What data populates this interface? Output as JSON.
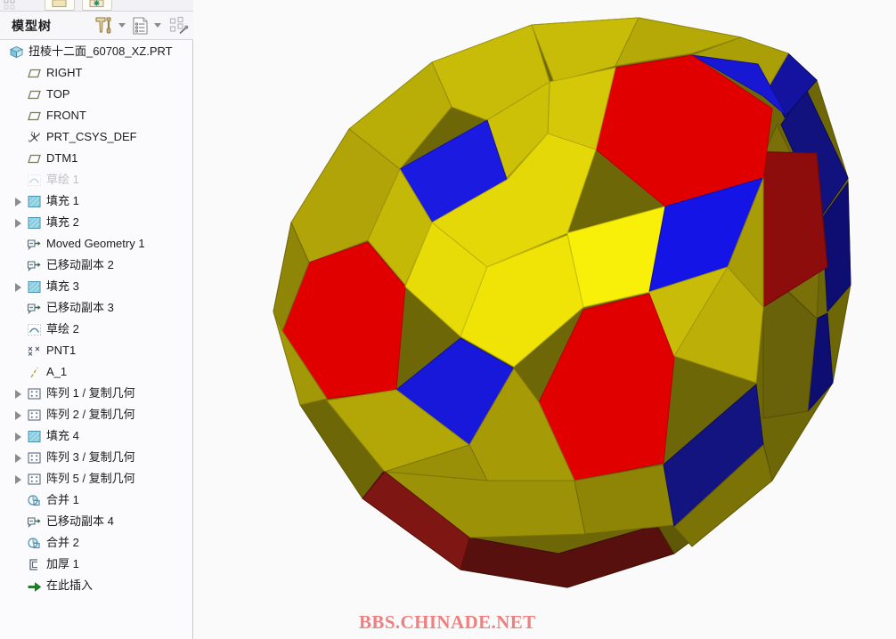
{
  "window": {
    "background": "#fafafa",
    "panel_background": "#fbfbfd"
  },
  "ribbon": {
    "buttons": [
      {
        "name": "new-window-button",
        "icon": "window-icon"
      },
      {
        "name": "style-button",
        "icon": "asterisk-icon"
      }
    ]
  },
  "panel": {
    "title": "模型树",
    "tools": [
      {
        "name": "settings-tools-button",
        "icon": "hammer-screwdriver-icon",
        "label": ""
      },
      {
        "name": "settings-dropdown",
        "icon": "chevron-down-icon",
        "label": ""
      },
      {
        "name": "display-list-button",
        "icon": "list-document-icon",
        "label": ""
      },
      {
        "name": "display-dropdown",
        "icon": "chevron-down-icon",
        "label": ""
      },
      {
        "name": "tree-filter-button",
        "icon": "tree-filter-icon",
        "label": ""
      }
    ]
  },
  "tree": {
    "items": [
      {
        "label": "扭棱十二面_60708_XZ.PRT",
        "icon": "part-cube-icon",
        "level": 0,
        "expander": false,
        "dim": false
      },
      {
        "label": "RIGHT",
        "icon": "datum-plane-icon",
        "level": 1,
        "expander": false,
        "dim": false
      },
      {
        "label": "TOP",
        "icon": "datum-plane-icon",
        "level": 1,
        "expander": false,
        "dim": false
      },
      {
        "label": "FRONT",
        "icon": "datum-plane-icon",
        "level": 1,
        "expander": false,
        "dim": false
      },
      {
        "label": "PRT_CSYS_DEF",
        "icon": "csys-icon",
        "level": 1,
        "expander": false,
        "dim": false
      },
      {
        "label": "DTM1",
        "icon": "datum-plane-icon",
        "level": 1,
        "expander": false,
        "dim": false
      },
      {
        "label": "草绘 1",
        "icon": "sketch-icon",
        "level": 1,
        "expander": false,
        "dim": true
      },
      {
        "label": "填充 1",
        "icon": "fill-icon",
        "level": 1,
        "expander": true,
        "dim": false
      },
      {
        "label": "填充 2",
        "icon": "fill-icon",
        "level": 1,
        "expander": true,
        "dim": false
      },
      {
        "label": "Moved Geometry 1",
        "icon": "moved-copy-icon",
        "level": 1,
        "expander": false,
        "dim": false
      },
      {
        "label": "已移动副本 2",
        "icon": "moved-copy-icon",
        "level": 1,
        "expander": false,
        "dim": false
      },
      {
        "label": "填充 3",
        "icon": "fill-icon",
        "level": 1,
        "expander": true,
        "dim": false
      },
      {
        "label": "已移动副本 3",
        "icon": "moved-copy-icon",
        "level": 1,
        "expander": false,
        "dim": false
      },
      {
        "label": "草绘 2",
        "icon": "sketch-icon",
        "level": 1,
        "expander": false,
        "dim": false
      },
      {
        "label": "PNT1",
        "icon": "point-icon",
        "level": 1,
        "expander": false,
        "dim": false
      },
      {
        "label": "A_1",
        "icon": "axis-icon",
        "level": 1,
        "expander": false,
        "dim": false
      },
      {
        "label": "阵列 1 / 复制几何",
        "icon": "pattern-icon",
        "level": 1,
        "expander": true,
        "dim": false
      },
      {
        "label": "阵列 2 / 复制几何",
        "icon": "pattern-icon",
        "level": 1,
        "expander": true,
        "dim": false
      },
      {
        "label": "填充 4",
        "icon": "fill-icon",
        "level": 1,
        "expander": true,
        "dim": false
      },
      {
        "label": "阵列 3 / 复制几何",
        "icon": "pattern-icon",
        "level": 1,
        "expander": true,
        "dim": false
      },
      {
        "label": "阵列 5 / 复制几何",
        "icon": "pattern-icon",
        "level": 1,
        "expander": true,
        "dim": false
      },
      {
        "label": "合并 1",
        "icon": "merge-icon",
        "level": 1,
        "expander": false,
        "dim": false
      },
      {
        "label": "已移动副本 4",
        "icon": "moved-copy-icon",
        "level": 1,
        "expander": false,
        "dim": false
      },
      {
        "label": "合并 2",
        "icon": "merge-icon",
        "level": 1,
        "expander": false,
        "dim": false
      },
      {
        "label": "加厚 1",
        "icon": "thicken-icon",
        "level": 1,
        "expander": false,
        "dim": false
      },
      {
        "label": "在此插入",
        "icon": "insert-here-icon",
        "level": 1,
        "expander": false,
        "dim": false
      }
    ]
  },
  "viewport": {
    "model_name": "扭棱十二面 (snub dodecahedron)",
    "colors": {
      "red_light": "#e00000",
      "red_dark": "#8d0c0c",
      "yellow_bright": "#f5ec07",
      "yellow_olive": "#c8bc08",
      "olive_dark": "#6e6708",
      "blue_bright": "#1010e8",
      "blue_dark": "#0d0d72",
      "background": "#fafafa"
    }
  },
  "watermark": {
    "text": "BBS.CHINADE.NET",
    "color": "#f08080"
  }
}
